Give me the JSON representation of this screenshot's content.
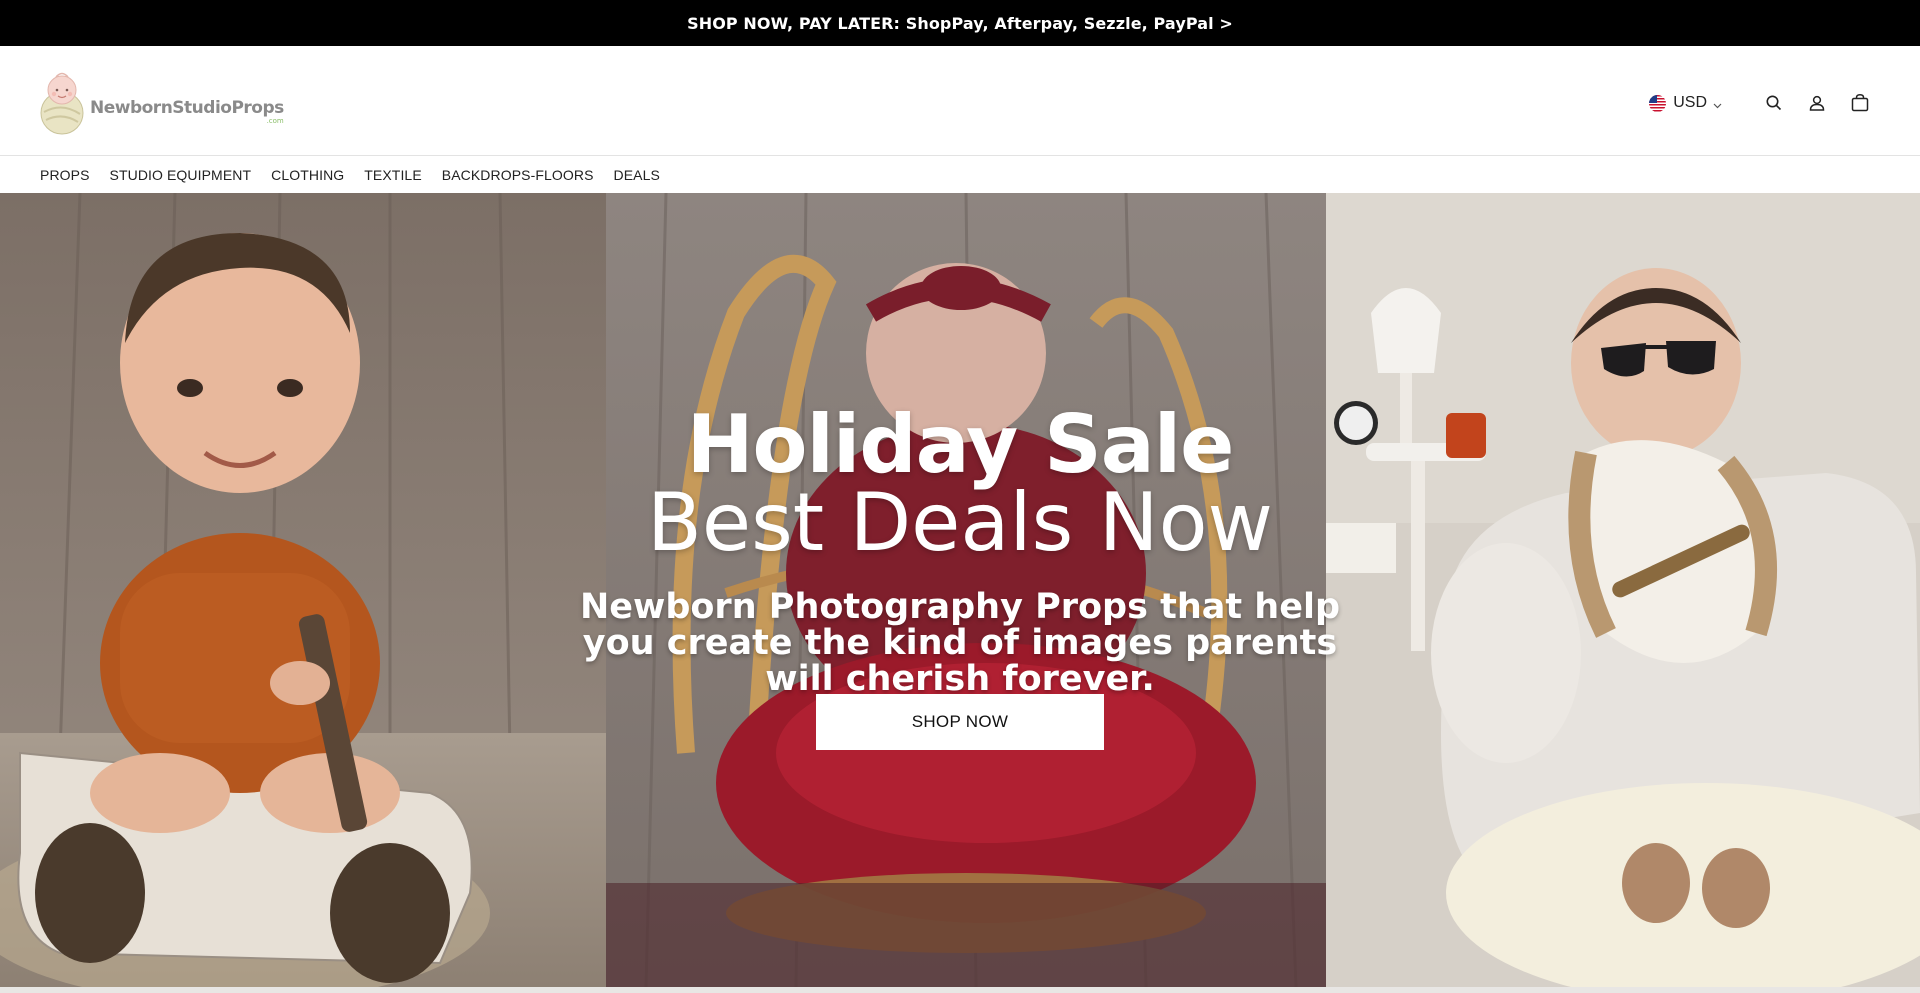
{
  "announcement": {
    "text": "SHOP NOW, PAY LATER: ShopPay, Afterpay, Sezzle, PayPal >"
  },
  "header": {
    "logo": {
      "text": "NewbornStudioProps",
      "suffix": ".com"
    },
    "currency": {
      "label": "USD",
      "flag_icon": "us-flag-icon"
    },
    "icons": [
      "search-icon",
      "account-icon",
      "cart-icon"
    ]
  },
  "nav": {
    "items": [
      {
        "label": "PROPS"
      },
      {
        "label": "STUDIO EQUIPMENT"
      },
      {
        "label": "CLOTHING"
      },
      {
        "label": "TEXTILE"
      },
      {
        "label": "BACKDROPS-FLOORS"
      },
      {
        "label": "DEALS"
      }
    ]
  },
  "hero": {
    "title": "Holiday Sale",
    "subtitle": "Best Deals Now",
    "body": "Newborn Photography Props that help you create the kind of images parents will cherish forever.",
    "button_label": "SHOP NOW"
  },
  "colors": {
    "announcement_bg": "#000000",
    "accent_red": "#8e1f2a",
    "text": "#111111"
  }
}
